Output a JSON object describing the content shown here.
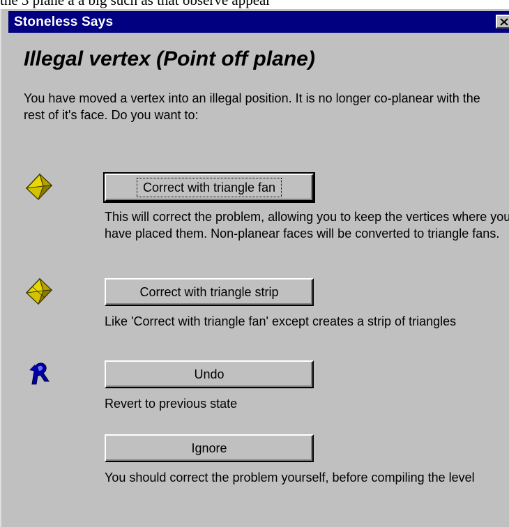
{
  "partial_top_text": "the 3 plane a a big such as that observe appear",
  "window": {
    "title": "Stoneless Says",
    "close_icon": "close-icon"
  },
  "heading": "Illegal vertex (Point off plane)",
  "intro": "You have moved a vertex into an illegal position. It is no longer co-planear with the rest of it's face. Do you want to:",
  "options": [
    {
      "icon": "polyhedron-fan-icon",
      "button_label": "Correct with triangle fan",
      "description": "This will correct the problem, allowing you to keep the vertices where you have placed them. Non-planear faces will be converted to triangle fans.",
      "focused": true
    },
    {
      "icon": "polyhedron-strip-icon",
      "button_label": "Correct with triangle strip",
      "description": "Like 'Correct with triangle fan' except creates a strip of triangles",
      "focused": false
    },
    {
      "icon": "undo-arrow-icon",
      "button_label": "Undo",
      "description": "Revert to previous state",
      "focused": false
    },
    {
      "icon": "",
      "button_label": "Ignore",
      "description": "You should correct the problem yourself, before compiling the level",
      "focused": false
    }
  ],
  "colors": {
    "titlebar": "#000080",
    "dialog_face": "#c0c0c0",
    "icon_yellow": "#e8d800",
    "undo_blue": "#0000a0"
  }
}
